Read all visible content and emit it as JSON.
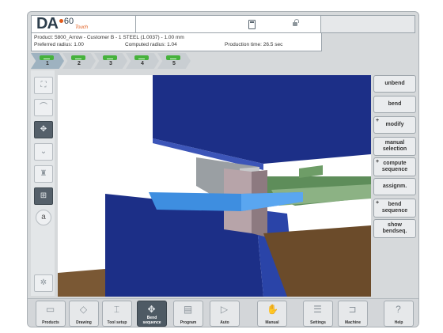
{
  "header": {
    "logo_text": "DA",
    "logo_number": "60",
    "logo_sub": "Touch",
    "calc_icon": "calculator-icon",
    "lock_icon": "lock-icon"
  },
  "info": {
    "line1": "Product: 5800_Arrow - Customer B - 1 STEEL (1.0037) - 1.00 mm",
    "preferred_radius": "Preferred radius: 1.00",
    "computed_radius": "Computed radius: 1.04",
    "production_time": "Production time: 26.5 sec"
  },
  "tabs": [
    {
      "label": "1",
      "active": true
    },
    {
      "label": "2",
      "active": false
    },
    {
      "label": "3",
      "active": false
    },
    {
      "label": "4",
      "active": false
    },
    {
      "label": "5",
      "active": false
    }
  ],
  "left_tools": [
    {
      "icon": "zoom-fit-icon"
    },
    {
      "icon": "rotate-icon"
    },
    {
      "icon": "view-3d-icon"
    },
    {
      "icon": "chevron-down-icon"
    },
    {
      "icon": "tool-icon"
    },
    {
      "icon": "bend-view-icon"
    },
    {
      "icon": "annotation-a-icon",
      "text": "a"
    },
    {
      "icon": "settings-pin-icon"
    }
  ],
  "right_buttons": [
    {
      "label": "unbend",
      "plus": false
    },
    {
      "label": "bend",
      "plus": false
    },
    {
      "label": "modify",
      "plus": true
    },
    {
      "label": "manual\nselection",
      "plus": false
    },
    {
      "label": "compute\nsequence",
      "plus": true
    },
    {
      "label": "assignm.",
      "plus": false
    },
    {
      "label": "bend\nsequence",
      "plus": true
    },
    {
      "label": "show\nbendseq.",
      "plus": false
    }
  ],
  "bottom_nav": [
    {
      "label": "Products",
      "icon": "folder-icon"
    },
    {
      "label": "Drawing",
      "icon": "drawing-icon"
    },
    {
      "label": "Tool setup",
      "icon": "tool-setup-icon"
    },
    {
      "label": "Bend\nsequence",
      "icon": "bend-sequence-icon",
      "active": true
    },
    {
      "label": "Program",
      "icon": "program-icon"
    },
    {
      "label": "Auto",
      "icon": "play-icon"
    },
    {
      "label": "Manual",
      "icon": "hand-icon"
    },
    {
      "label": "Settings",
      "icon": "settings-icon"
    },
    {
      "label": "Machine",
      "icon": "machine-icon"
    },
    {
      "label": "Help",
      "icon": "help-icon"
    }
  ],
  "colors": {
    "accent_green": "#46b23c",
    "sheet_blue": "#3e8ee0",
    "machine_navy": "#1c2f87",
    "floor_brown": "#6b4b2a"
  }
}
